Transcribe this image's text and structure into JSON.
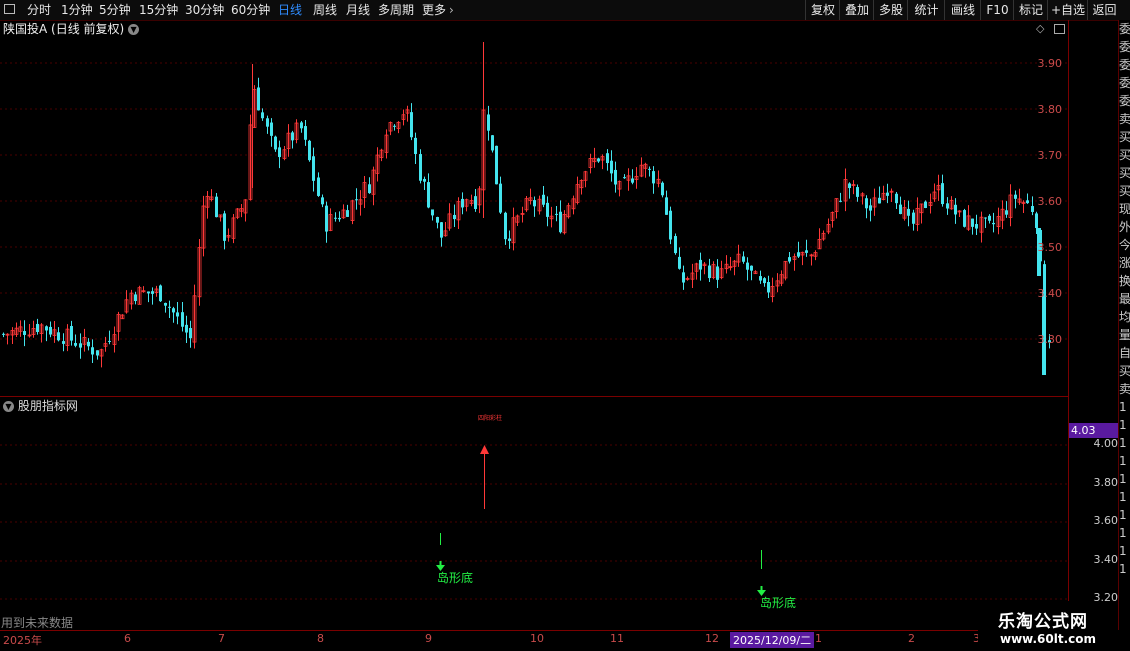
{
  "toolbar": {
    "periods": [
      "分时",
      "1分钟",
      "5分钟",
      "15分钟",
      "30分钟",
      "60分钟",
      "日线",
      "周线",
      "月线",
      "多周期",
      "更多"
    ],
    "active_period": "日线",
    "more_chevron": "›",
    "right_buttons": [
      "复权",
      "叠加",
      "多股",
      "统计",
      "画线",
      "F10",
      "标记",
      "+自选",
      "返回"
    ]
  },
  "main_chart": {
    "title": "陕国投A (日线 前复权)",
    "price_labels": [
      "3.90",
      "3.80",
      "3.70",
      "3.60",
      "3.50",
      "3.40",
      "3.30"
    ]
  },
  "indicator": {
    "title": "股朋指标网",
    "value_badge": "4.03",
    "axis_labels": [
      "4.00",
      "3.80",
      "3.60",
      "3.40",
      "3.20"
    ],
    "signal_top": "四阳彩柱",
    "signal_bottom_1": "岛形底",
    "signal_bottom_2": "岛形底",
    "footer_note": "用到未来数据"
  },
  "time_axis": {
    "labels": [
      "2025年",
      "6",
      "7",
      "8",
      "9",
      "10",
      "11",
      "12",
      "2025/12/09/二",
      "1",
      "2",
      "3"
    ]
  },
  "sidebar": {
    "chars": [
      "委",
      "委",
      "委",
      "委",
      "委",
      "卖",
      "买",
      "买",
      "买",
      "买",
      "现",
      "外",
      "今",
      "涨",
      "换",
      "最",
      "均",
      "量",
      "自",
      "买",
      "卖",
      "1",
      "1",
      "1",
      "1",
      "1",
      "1",
      "1",
      "1",
      "1",
      "1"
    ]
  },
  "watermark": {
    "line1": "乐淘公式网",
    "line2": "www.60lt.com"
  },
  "colors": {
    "up": "#ff3838",
    "down": "#44e4ee",
    "grid": "#5a0000",
    "axis_label": "#c94b4b",
    "active_tab": "#2f8cff",
    "badge_bg": "#5a1aa0"
  }
}
